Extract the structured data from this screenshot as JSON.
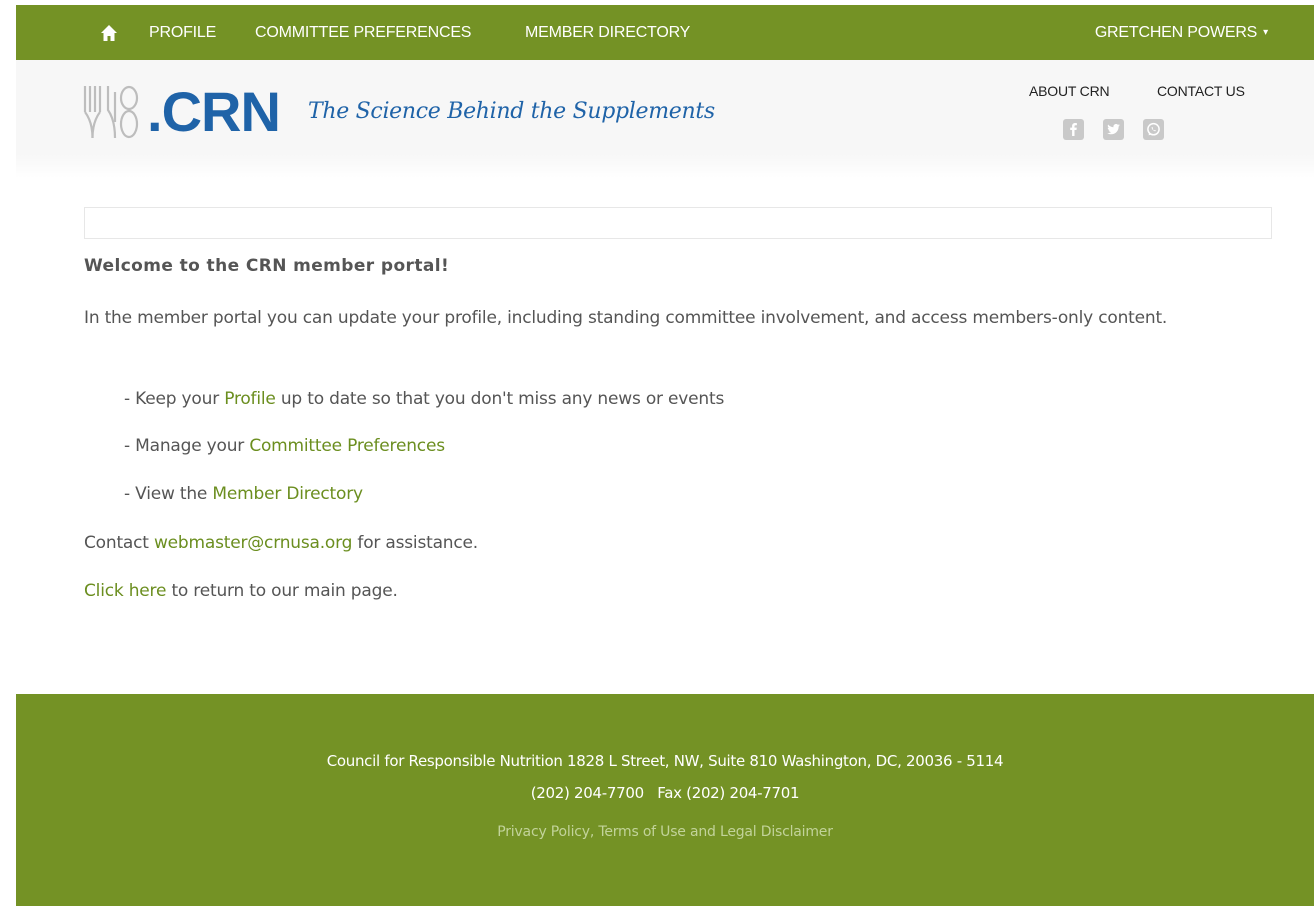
{
  "topnav": {
    "home_icon": "home-icon",
    "profile": "PROFILE",
    "committee": "COMMITTEE PREFERENCES",
    "directory": "MEMBER DIRECTORY",
    "user": "GRETCHEN POWERS",
    "user_caret": "▾",
    "bg_color": "#749225"
  },
  "header": {
    "logo_text": "CRN",
    "logo_dot": ".",
    "tagline": "The Science Behind the Supplements",
    "about": "ABOUT CRN",
    "contact": "CONTACT US",
    "social_icons": [
      "facebook-icon",
      "twitter-icon",
      "whatsapp-icon"
    ],
    "brand_color": "#1f63a8"
  },
  "content": {
    "welcome": "Welcome to the CRN member portal!",
    "intro": "In the member portal you can update your profile, including standing committee involvement, and access members-only content.",
    "bullet1_pre": "- Keep your ",
    "bullet1_link": "Profile",
    "bullet1_post": " up to date so that you don't miss any news or events",
    "bullet2_pre": "- Manage your ",
    "bullet2_link": "Committee Preferences",
    "bullet3_pre": "- View the ",
    "bullet3_link": "Member Directory",
    "contact_pre": "Contact ",
    "contact_link": "webmaster@crnusa.org",
    "contact_post": " for assistance.",
    "click_link": "Click here",
    "click_post": " to return to our main page.",
    "link_color": "#6b8e1f"
  },
  "footer": {
    "address": "Council for Responsible Nutrition 1828 L Street, NW, Suite 810 Washington, DC, 20036 - 5114",
    "phone": "(202) 204-7700   Fax (202) 204-7701",
    "legal": "Privacy Policy, Terms of Use and Legal Disclaimer"
  }
}
